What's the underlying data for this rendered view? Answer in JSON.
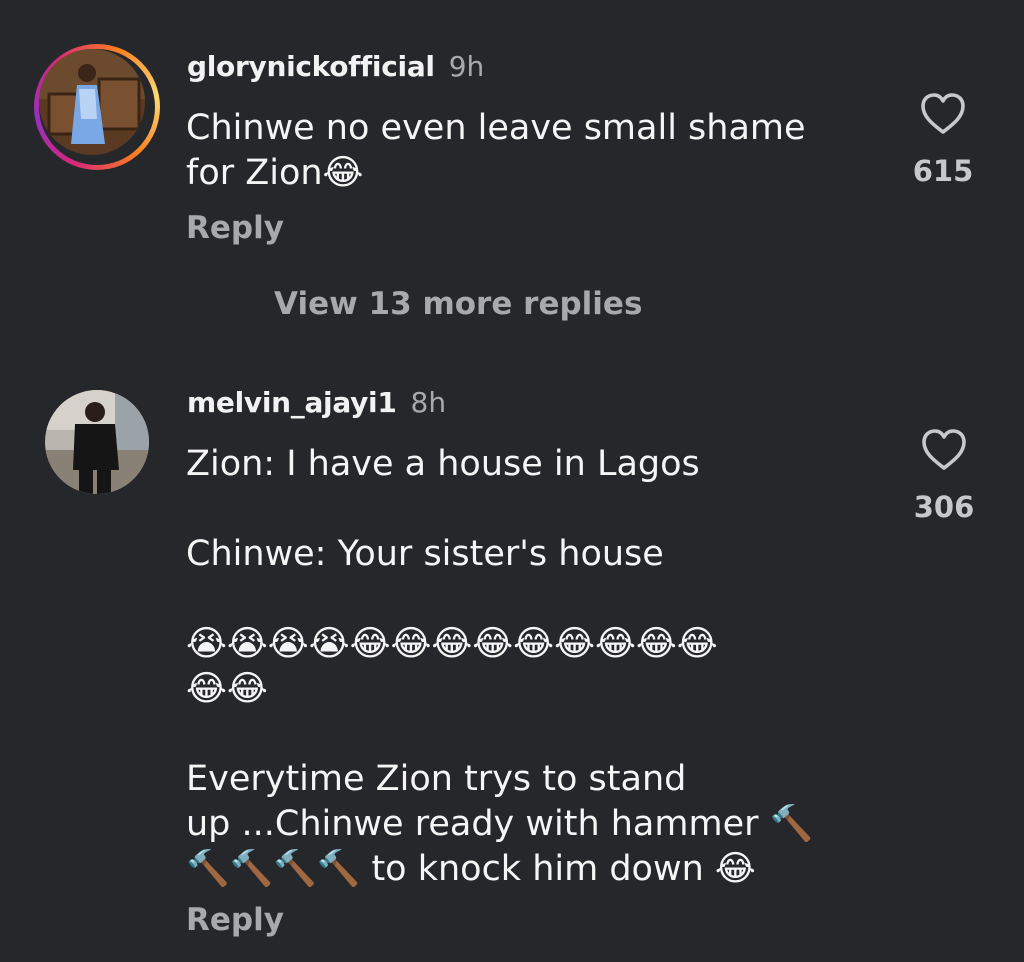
{
  "comments": [
    {
      "username": "glorynickofficial",
      "time": "9h",
      "text": "Chinwe no even leave small shame\nfor Zion😂",
      "likes": "615",
      "reply_label": "Reply",
      "avatar_story_ring": true
    },
    {
      "username": "melvin_ajayi1",
      "time": "8h",
      "text": "Zion: I have a house in Lagos\n\nChinwe: Your sister's house\n\n😭😭😭😭😂😂😂😂😂😂😂😂😂\n😂😂\n\nEverytime Zion trys to stand\nup ...Chinwe ready with hammer 🔨\n🔨🔨🔨🔨 to knock him down 😂",
      "likes": "306",
      "reply_label": "Reply",
      "avatar_story_ring": false
    }
  ],
  "view_more_replies": "View 13 more replies",
  "icons": {
    "like": "heart-outline-icon"
  },
  "colors": {
    "background": "#26272b",
    "muted_text": "#a8a9ad",
    "text": "#f5f5f5"
  }
}
